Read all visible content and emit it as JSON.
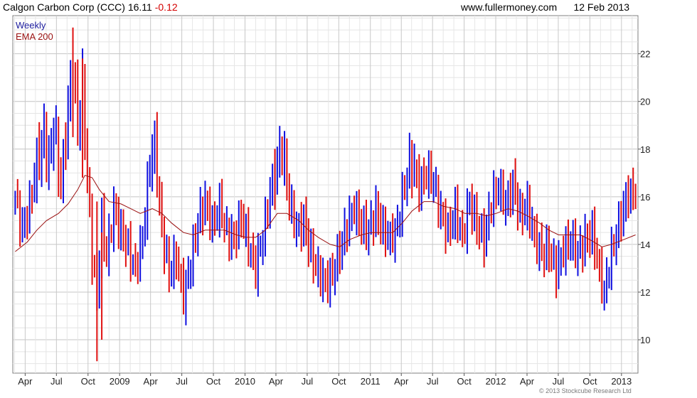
{
  "header": {
    "title": "Calgon Carbon Corp (CCC)",
    "price": "16.11",
    "change": "-0.12",
    "site": "www.fullermoney.com",
    "date": "12 Feb 2013"
  },
  "footer": {
    "copyright": "© 2013 Stockcube Research Ltd"
  },
  "colors": {
    "up": "#1010e0",
    "down": "#e01010",
    "ema": "#9a1010",
    "legend_weekly": "#1a1a9c",
    "legend_ema": "#9a1010",
    "grid": "#d6d6d6"
  },
  "chart_data": {
    "type": "candlestick",
    "title": "Calgon Carbon Corp (CCC)",
    "legend": [
      {
        "label": "Weekly",
        "color": "#1a1a9c"
      },
      {
        "label": "EMA 200",
        "color": "#9a1010"
      }
    ],
    "legend_position": "top-left",
    "grid": true,
    "ylim": [
      8.6,
      23.6
    ],
    "xlim": [
      "2008-02-25",
      "2013-02-18"
    ],
    "y_ticks": [
      10,
      12,
      14,
      16,
      18,
      20,
      22
    ],
    "x_ticks": [
      {
        "date": "2008-04-01",
        "label": "Apr"
      },
      {
        "date": "2008-07-01",
        "label": "Jul"
      },
      {
        "date": "2008-10-01",
        "label": "Oct"
      },
      {
        "date": "2009-01-01",
        "label": "2009"
      },
      {
        "date": "2009-04-01",
        "label": "Apr"
      },
      {
        "date": "2009-07-01",
        "label": "Jul"
      },
      {
        "date": "2009-10-01",
        "label": "Oct"
      },
      {
        "date": "2010-01-01",
        "label": "2010"
      },
      {
        "date": "2010-04-01",
        "label": "Apr"
      },
      {
        "date": "2010-07-01",
        "label": "Jul"
      },
      {
        "date": "2010-10-01",
        "label": "Oct"
      },
      {
        "date": "2011-01-01",
        "label": "2011"
      },
      {
        "date": "2011-04-01",
        "label": "Apr"
      },
      {
        "date": "2011-07-01",
        "label": "Jul"
      },
      {
        "date": "2011-10-01",
        "label": "Oct"
      },
      {
        "date": "2012-01-01",
        "label": "2012"
      },
      {
        "date": "2012-04-01",
        "label": "Apr"
      },
      {
        "date": "2012-07-01",
        "label": "Jul"
      },
      {
        "date": "2012-10-01",
        "label": "Oct"
      },
      {
        "date": "2013-01-01",
        "label": "2013"
      }
    ],
    "close_path": [
      [
        "2008-03-03",
        16.0
      ],
      [
        "2008-03-24",
        14.6
      ],
      [
        "2008-04-14",
        15.6
      ],
      [
        "2008-05-05",
        17.5
      ],
      [
        "2008-05-26",
        18.6
      ],
      [
        "2008-06-09",
        17.2
      ],
      [
        "2008-06-23",
        19.1
      ],
      [
        "2008-07-14",
        16.5
      ],
      [
        "2008-08-04",
        19.8
      ],
      [
        "2008-08-18",
        21.5
      ],
      [
        "2008-09-01",
        19.0
      ],
      [
        "2008-09-15",
        20.6
      ],
      [
        "2008-09-29",
        16.8
      ],
      [
        "2008-10-13",
        13.5
      ],
      [
        "2008-10-27",
        11.9
      ],
      [
        "2008-11-10",
        15.0
      ],
      [
        "2008-11-24",
        13.5
      ],
      [
        "2008-12-15",
        15.5
      ],
      [
        "2009-01-05",
        14.5
      ],
      [
        "2009-01-26",
        13.8
      ],
      [
        "2009-02-16",
        13.0
      ],
      [
        "2009-03-09",
        14.2
      ],
      [
        "2009-03-30",
        17.5
      ],
      [
        "2009-04-13",
        18.2
      ],
      [
        "2009-05-04",
        14.5
      ],
      [
        "2009-05-25",
        12.8
      ],
      [
        "2009-06-15",
        13.5
      ],
      [
        "2009-07-06",
        11.8
      ],
      [
        "2009-07-27",
        13.2
      ],
      [
        "2009-08-17",
        15.0
      ],
      [
        "2009-09-07",
        15.8
      ],
      [
        "2009-09-28",
        14.8
      ],
      [
        "2009-10-19",
        15.6
      ],
      [
        "2009-11-09",
        14.5
      ],
      [
        "2009-11-30",
        14.2
      ],
      [
        "2009-12-21",
        15.2
      ],
      [
        "2010-01-11",
        14.0
      ],
      [
        "2010-02-01",
        13.0
      ],
      [
        "2010-02-22",
        14.3
      ],
      [
        "2010-03-15",
        16.2
      ],
      [
        "2010-04-05",
        17.5
      ],
      [
        "2010-04-19",
        18.0
      ],
      [
        "2010-05-10",
        15.8
      ],
      [
        "2010-05-31",
        14.6
      ],
      [
        "2010-06-21",
        15.0
      ],
      [
        "2010-07-12",
        13.6
      ],
      [
        "2010-08-02",
        12.8
      ],
      [
        "2010-08-23",
        12.4
      ],
      [
        "2010-09-13",
        12.7
      ],
      [
        "2010-10-04",
        13.8
      ],
      [
        "2010-10-25",
        14.8
      ],
      [
        "2010-11-15",
        15.5
      ],
      [
        "2010-12-06",
        14.8
      ],
      [
        "2010-12-27",
        14.6
      ],
      [
        "2011-01-17",
        15.4
      ],
      [
        "2011-02-07",
        14.6
      ],
      [
        "2011-02-28",
        14.2
      ],
      [
        "2011-03-21",
        14.8
      ],
      [
        "2011-04-11",
        16.5
      ],
      [
        "2011-05-02",
        17.5
      ],
      [
        "2011-05-23",
        16.4
      ],
      [
        "2011-06-13",
        17.0
      ],
      [
        "2011-07-04",
        16.6
      ],
      [
        "2011-07-25",
        15.3
      ],
      [
        "2011-08-15",
        14.5
      ],
      [
        "2011-09-05",
        15.4
      ],
      [
        "2011-09-26",
        14.3
      ],
      [
        "2011-10-17",
        15.8
      ],
      [
        "2011-11-07",
        14.8
      ],
      [
        "2011-11-28",
        14.2
      ],
      [
        "2011-12-19",
        15.8
      ],
      [
        "2012-01-09",
        16.4
      ],
      [
        "2012-01-30",
        15.6
      ],
      [
        "2012-02-20",
        16.6
      ],
      [
        "2012-03-12",
        15.2
      ],
      [
        "2012-04-02",
        15.6
      ],
      [
        "2012-04-23",
        14.3
      ],
      [
        "2012-05-14",
        13.6
      ],
      [
        "2012-06-04",
        13.8
      ],
      [
        "2012-06-25",
        12.9
      ],
      [
        "2012-07-16",
        13.8
      ],
      [
        "2012-08-06",
        14.2
      ],
      [
        "2012-08-27",
        13.6
      ],
      [
        "2012-09-17",
        14.2
      ],
      [
        "2012-10-08",
        14.5
      ],
      [
        "2012-10-29",
        12.8
      ],
      [
        "2012-11-12",
        11.9
      ],
      [
        "2012-11-26",
        13.2
      ],
      [
        "2012-12-10",
        14.0
      ],
      [
        "2012-12-31",
        15.2
      ],
      [
        "2013-01-21",
        16.2
      ],
      [
        "2013-02-11",
        16.11
      ]
    ],
    "ema_200": [
      [
        "2008-03-03",
        13.7
      ],
      [
        "2008-04-07",
        14.1
      ],
      [
        "2008-05-05",
        14.6
      ],
      [
        "2008-06-02",
        15.0
      ],
      [
        "2008-07-07",
        15.3
      ],
      [
        "2008-08-04",
        15.7
      ],
      [
        "2008-09-01",
        16.3
      ],
      [
        "2008-09-22",
        16.9
      ],
      [
        "2008-10-13",
        16.8
      ],
      [
        "2008-11-03",
        16.3
      ],
      [
        "2008-12-01",
        15.8
      ],
      [
        "2009-01-05",
        15.7
      ],
      [
        "2009-02-02",
        15.5
      ],
      [
        "2009-03-02",
        15.3
      ],
      [
        "2009-04-06",
        15.5
      ],
      [
        "2009-05-04",
        15.3
      ],
      [
        "2009-06-01",
        14.9
      ],
      [
        "2009-07-06",
        14.5
      ],
      [
        "2009-08-03",
        14.4
      ],
      [
        "2009-09-07",
        14.6
      ],
      [
        "2009-10-05",
        14.6
      ],
      [
        "2009-11-02",
        14.6
      ],
      [
        "2009-12-07",
        14.4
      ],
      [
        "2010-01-04",
        14.3
      ],
      [
        "2010-02-01",
        14.3
      ],
      [
        "2010-03-01",
        14.6
      ],
      [
        "2010-04-05",
        15.3
      ],
      [
        "2010-05-03",
        15.3
      ],
      [
        "2010-06-07",
        15.0
      ],
      [
        "2010-07-05",
        14.6
      ],
      [
        "2010-08-02",
        14.3
      ],
      [
        "2010-09-06",
        14.0
      ],
      [
        "2010-10-04",
        13.9
      ],
      [
        "2010-11-01",
        14.2
      ],
      [
        "2010-12-06",
        14.4
      ],
      [
        "2011-01-03",
        14.5
      ],
      [
        "2011-02-07",
        14.5
      ],
      [
        "2011-03-07",
        14.5
      ],
      [
        "2011-04-04",
        14.9
      ],
      [
        "2011-05-02",
        15.4
      ],
      [
        "2011-06-06",
        15.8
      ],
      [
        "2011-07-04",
        15.8
      ],
      [
        "2011-08-01",
        15.6
      ],
      [
        "2011-09-05",
        15.5
      ],
      [
        "2011-10-03",
        15.3
      ],
      [
        "2011-11-07",
        15.3
      ],
      [
        "2011-12-05",
        15.2
      ],
      [
        "2012-01-02",
        15.3
      ],
      [
        "2012-02-06",
        15.5
      ],
      [
        "2012-03-05",
        15.4
      ],
      [
        "2012-04-02",
        15.2
      ],
      [
        "2012-05-07",
        14.9
      ],
      [
        "2012-06-04",
        14.6
      ],
      [
        "2012-07-02",
        14.4
      ],
      [
        "2012-08-06",
        14.4
      ],
      [
        "2012-09-03",
        14.4
      ],
      [
        "2012-10-01",
        14.2
      ],
      [
        "2012-11-05",
        13.9
      ],
      [
        "2012-12-03",
        14.0
      ],
      [
        "2013-01-07",
        14.2
      ],
      [
        "2013-02-11",
        14.4
      ]
    ],
    "spikes": [
      {
        "date": "2008-08-18",
        "high": 23.1,
        "low": 18.5
      },
      {
        "date": "2008-09-15",
        "high": 21.8,
        "low": 16.8
      },
      {
        "date": "2008-10-27",
        "high": 15.8,
        "low": 9.1
      },
      {
        "date": "2008-11-10",
        "high": 14.5,
        "low": 10.0
      }
    ]
  }
}
